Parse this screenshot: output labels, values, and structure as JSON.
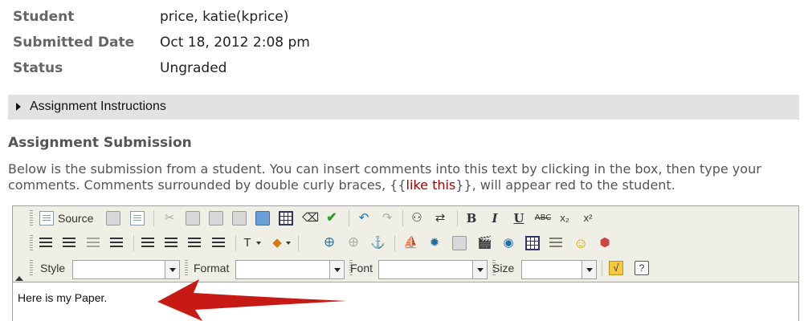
{
  "meta": [
    {
      "label": "Student",
      "value": "price, katie(kprice)"
    },
    {
      "label": "Submitted Date",
      "value": "Oct 18, 2012 2:08 pm"
    },
    {
      "label": "Status",
      "value": "Ungraded"
    }
  ],
  "instructions": {
    "label": "Assignment Instructions"
  },
  "submission": {
    "heading": "Assignment Submission",
    "desc_before": "Below is the submission from a student. You can insert comments into this text by clicking in the box, then type your comments. Comments surrounded by double curly braces, {{",
    "desc_red": "like this",
    "desc_after": "}}, will appear red to the student."
  },
  "editor": {
    "source_label": "Source",
    "style_label": "Style",
    "format_label": "Format",
    "font_label": "Font",
    "size_label": "Size",
    "style_value": "",
    "format_value": "",
    "font_value": "",
    "size_value": "",
    "content": "Here is my Paper."
  },
  "colors": {
    "arrow": "#c81a14",
    "header_bar": "#e2e2e2",
    "comment_red": "#a40000"
  }
}
